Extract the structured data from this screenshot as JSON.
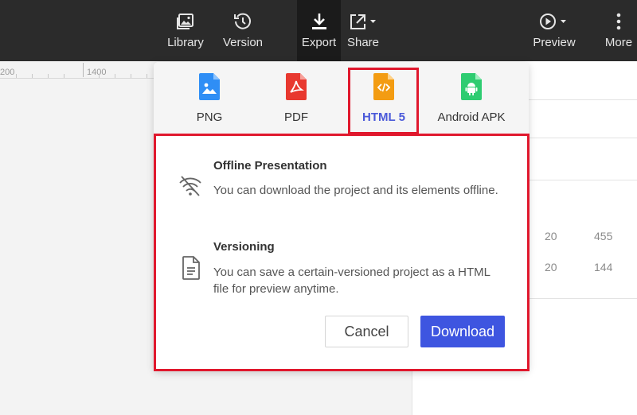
{
  "toolbar": {
    "items": [
      {
        "label": "Library",
        "icon": "image-library-icon"
      },
      {
        "label": "Version",
        "icon": "history-icon"
      },
      {
        "label": "Export",
        "icon": "download-icon",
        "active": true
      },
      {
        "label": "Share",
        "icon": "share-icon"
      },
      {
        "label": "Preview",
        "icon": "play-circle-icon"
      },
      {
        "label": "More",
        "icon": "vertical-dots-icon"
      }
    ]
  },
  "ruler": {
    "labels": [
      "200",
      "1400"
    ]
  },
  "right_panel": {
    "rows": [
      {
        "a": "20",
        "b": "455"
      },
      {
        "a": "20",
        "b": "144"
      }
    ]
  },
  "export_dialog": {
    "formats": [
      {
        "label": "PNG",
        "icon": "png-file-icon",
        "color": "#2f8ef5"
      },
      {
        "label": "PDF",
        "icon": "pdf-file-icon",
        "color": "#e8382f"
      },
      {
        "label": "HTML 5",
        "icon": "html-file-icon",
        "color": "#f39c12",
        "selected": true
      },
      {
        "label": "Android APK",
        "icon": "android-file-icon",
        "color": "#2ecc71"
      }
    ],
    "features": [
      {
        "title": "Offline Presentation",
        "desc": "You can download the project and its elements offline.",
        "icon": "wifi-off-icon"
      },
      {
        "title": "Versioning",
        "desc": "You can save a certain-versioned project as a HTML file for preview anytime.",
        "icon": "document-icon"
      }
    ],
    "cancel_label": "Cancel",
    "download_label": "Download"
  },
  "colors": {
    "accent": "#3e55e0",
    "highlight": "#e0182d",
    "toolbar": "#2b2b2b",
    "selected_text": "#4a59d9"
  }
}
